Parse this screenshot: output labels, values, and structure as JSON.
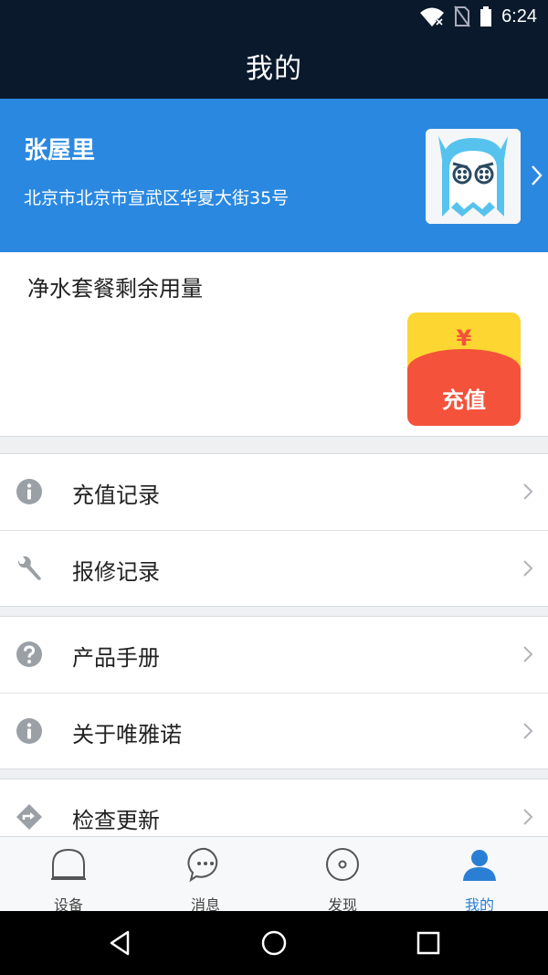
{
  "status_bar": {
    "time": "6:24"
  },
  "header": {
    "title": "我的"
  },
  "profile": {
    "name": "张屋里",
    "address": "北京市北京市宣武区华夏大街35号"
  },
  "package": {
    "title": "净水套餐剩余用量",
    "recharge_symbol": "¥",
    "recharge_label": "充值"
  },
  "menu_groups": [
    [
      {
        "label": "充值记录",
        "icon": "info-icon"
      },
      {
        "label": "报修记录",
        "icon": "wrench-icon"
      }
    ],
    [
      {
        "label": "产品手册",
        "icon": "question-icon"
      },
      {
        "label": "关于唯雅诺",
        "icon": "info-icon"
      }
    ],
    [
      {
        "label": "检查更新",
        "icon": "update-icon"
      }
    ]
  ],
  "tabs": [
    {
      "label": "设备",
      "icon": "device-icon"
    },
    {
      "label": "消息",
      "icon": "message-icon"
    },
    {
      "label": "发现",
      "icon": "discover-icon"
    },
    {
      "label": "我的",
      "icon": "profile-icon",
      "active": true
    }
  ],
  "colors": {
    "header_bg": "#0a1a2c",
    "profile_bg": "#2a88e0",
    "accent": "#2a7fd4",
    "recharge_yellow": "#fdd631",
    "recharge_red": "#f4523b"
  }
}
